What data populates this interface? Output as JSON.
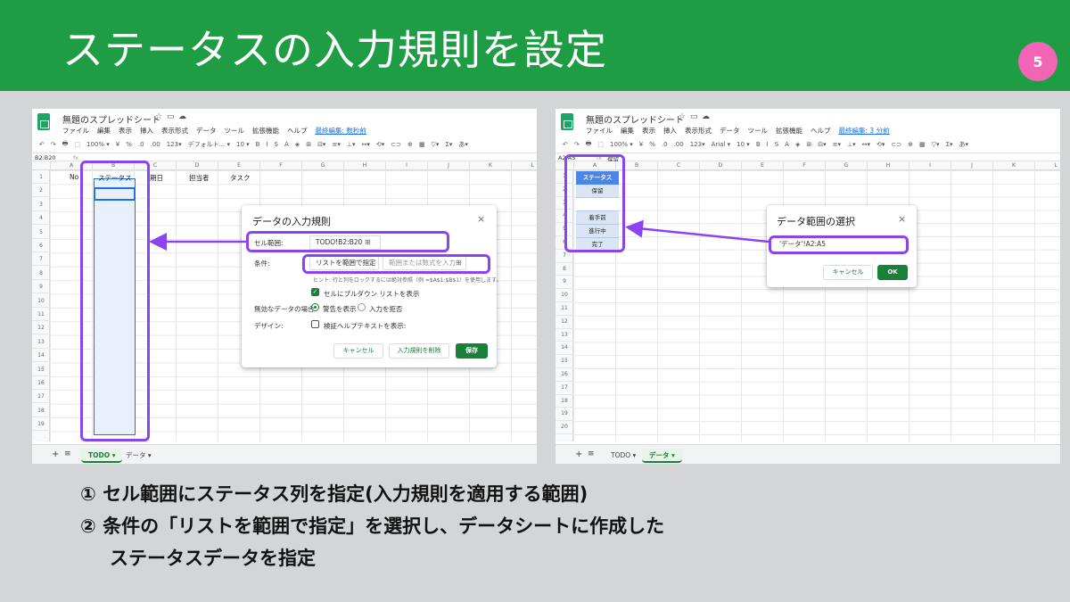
{
  "slide": {
    "title": "ステータスの入力規則を設定",
    "page_number": "5",
    "steps": [
      "① セル範囲にステータス列を指定(入力規則を適用する範囲)",
      "② 条件の「リストを範囲で指定」を選択し、データシートに作成した",
      "ステータスデータを指定"
    ]
  },
  "colors": {
    "header": "#1f9d45",
    "badge": "#f264b4",
    "highlight": "#8b45f0",
    "sheets_green": "#188038",
    "selection": "#1a73e8"
  },
  "shot1": {
    "doc_title": "無題のスプレッドシート",
    "menu": [
      "ファイル",
      "編集",
      "表示",
      "挿入",
      "表示形式",
      "データ",
      "ツール",
      "拡張機能",
      "ヘルプ"
    ],
    "last_edit": "最終編集: 数秒前",
    "toolbar": [
      "↶",
      "↷",
      "🖶",
      "⬚",
      "100% ▾",
      "¥",
      "%",
      ".0",
      ".00",
      "123▾",
      "デフォルト... ▾",
      "10 ▾",
      "B",
      "I",
      "S",
      "A",
      "◈",
      "⊞",
      "⊟▾",
      "≡▾",
      "⊥▾",
      "↔▾",
      "⟲▾",
      "⊂⊃",
      "⊕",
      "▦",
      "▽▾",
      "Σ▾",
      "あ▾"
    ],
    "cell_ref": "B2:B20",
    "fx": "fx",
    "columns": [
      "A",
      "B",
      "C",
      "D",
      "E",
      "F",
      "G",
      "H",
      "I",
      "J",
      "K",
      "L"
    ],
    "rows": [
      "1",
      "2",
      "3",
      "4",
      "5",
      "6",
      "7",
      "8",
      "9",
      "10",
      "11",
      "12",
      "13",
      "14",
      "15",
      "16",
      "17",
      "18",
      "19"
    ],
    "headers": [
      "No",
      "ステータス",
      "期日",
      "担当者",
      "タスク"
    ],
    "dialog": {
      "title": "データの入力規則",
      "close": "×",
      "range_label": "セル範囲:",
      "range_value": "TODO!B2:B20",
      "criteria_label": "条件:",
      "criteria_value": "リストを範囲で指定 ▾",
      "criteria_placeholder": "範囲または数式を入力",
      "hint": "ヒント: 行と列をロックするには絶対参照（例 =$A$1:$B$1）を使用します。",
      "dropdown_label": "セルにプルダウン リストを表示",
      "invalid_label": "無効なデータの場合:",
      "warn_label": "警告を表示",
      "reject_label": "入力を拒否",
      "design_label": "デザイン:",
      "help_label": "検証ヘルプテキストを表示:",
      "cancel": "キャンセル",
      "remove": "入力規則を削除",
      "save": "保存"
    },
    "tabs": {
      "plus": "+",
      "list": "≡",
      "active": "TODO ▾",
      "other": "データ ▾"
    }
  },
  "shot2": {
    "doc_title": "無題のスプレッドシート",
    "menu": [
      "ファイル",
      "編集",
      "表示",
      "挿入",
      "表示形式",
      "データ",
      "ツール",
      "拡張機能",
      "ヘルプ"
    ],
    "last_edit": "最終編集: 3 分前",
    "toolbar": [
      "↶",
      "↷",
      "🖶",
      "⬚",
      "100% ▾",
      "¥",
      "%",
      ".0",
      ".00",
      "123▾",
      "Arial ▾",
      "10 ▾",
      "B",
      "I",
      "S",
      "A",
      "◈",
      "⊞",
      "⊟▾",
      "≡▾",
      "⊥▾",
      "↔▾",
      "⟲▾",
      "⊂⊃",
      "⊕",
      "▦",
      "▽▾",
      "Σ▾",
      "あ▾"
    ],
    "cell_ref": "A2:A5",
    "fx": "fx",
    "fx_value": "保留",
    "columns": [
      "A",
      "B",
      "C",
      "D",
      "E",
      "F",
      "G",
      "H",
      "I",
      "J",
      "K",
      "L"
    ],
    "rows": [
      "1",
      "2",
      "3",
      "4",
      "5",
      "6",
      "7",
      "8",
      "9",
      "10",
      "11",
      "12",
      "13",
      "14",
      "15",
      "16",
      "17",
      "18",
      "19",
      "20"
    ],
    "data_items": [
      "ステータス",
      "保留",
      "着手前",
      "進行中",
      "完了"
    ],
    "dialog": {
      "title": "データ範囲の選択",
      "close": "×",
      "range_value": "'データ'!A2:A5",
      "cancel": "キャンセル",
      "ok": "OK"
    },
    "tabs": {
      "plus": "+",
      "list": "≡",
      "other": "TODO ▾",
      "active": "データ ▾"
    }
  }
}
